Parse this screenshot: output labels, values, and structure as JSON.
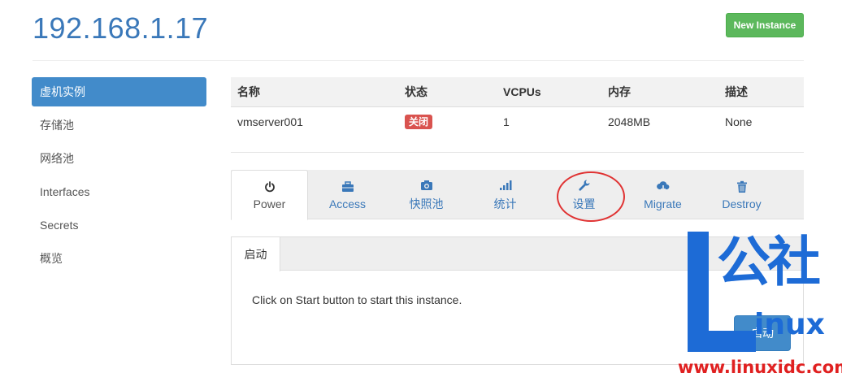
{
  "header": {
    "host_title": "192.168.1.17",
    "new_instance_label": "New Instance"
  },
  "sidebar": {
    "items": [
      {
        "label": "虚机实例",
        "active": true
      },
      {
        "label": "存储池"
      },
      {
        "label": "网络池"
      },
      {
        "label": "Interfaces"
      },
      {
        "label": "Secrets"
      },
      {
        "label": "概览"
      }
    ]
  },
  "table": {
    "columns": [
      "名称",
      "状态",
      "VCPUs",
      "内存",
      "描述"
    ],
    "rows": [
      {
        "name": "vmserver001",
        "status": "关闭",
        "vcpus": "1",
        "memory": "2048MB",
        "description": "None"
      }
    ]
  },
  "tabs": [
    {
      "label": "Power",
      "icon": "power-icon",
      "active": true
    },
    {
      "label": "Access",
      "icon": "briefcase-icon"
    },
    {
      "label": "快照池",
      "icon": "camera-icon"
    },
    {
      "label": "统计",
      "icon": "signal-bars-icon"
    },
    {
      "label": "设置",
      "icon": "wrench-icon",
      "highlighted": true
    },
    {
      "label": "Migrate",
      "icon": "cloud-download-icon"
    },
    {
      "label": "Destroy",
      "icon": "trash-icon"
    }
  ],
  "power_panel": {
    "subtab_label": "启动",
    "message": "Click on Start button to start this instance.",
    "start_button_label": "启动"
  },
  "watermark": {
    "logo_cjk": "公社",
    "logo_latin": "inux",
    "url": "www.linuxidc.com"
  },
  "colors": {
    "accent": "#3a78b9",
    "primary": "#428bca",
    "success": "#5cb85c",
    "danger": "#d9534f",
    "watermark_blue": "#1d6bd6",
    "watermark_red": "#e02020"
  }
}
